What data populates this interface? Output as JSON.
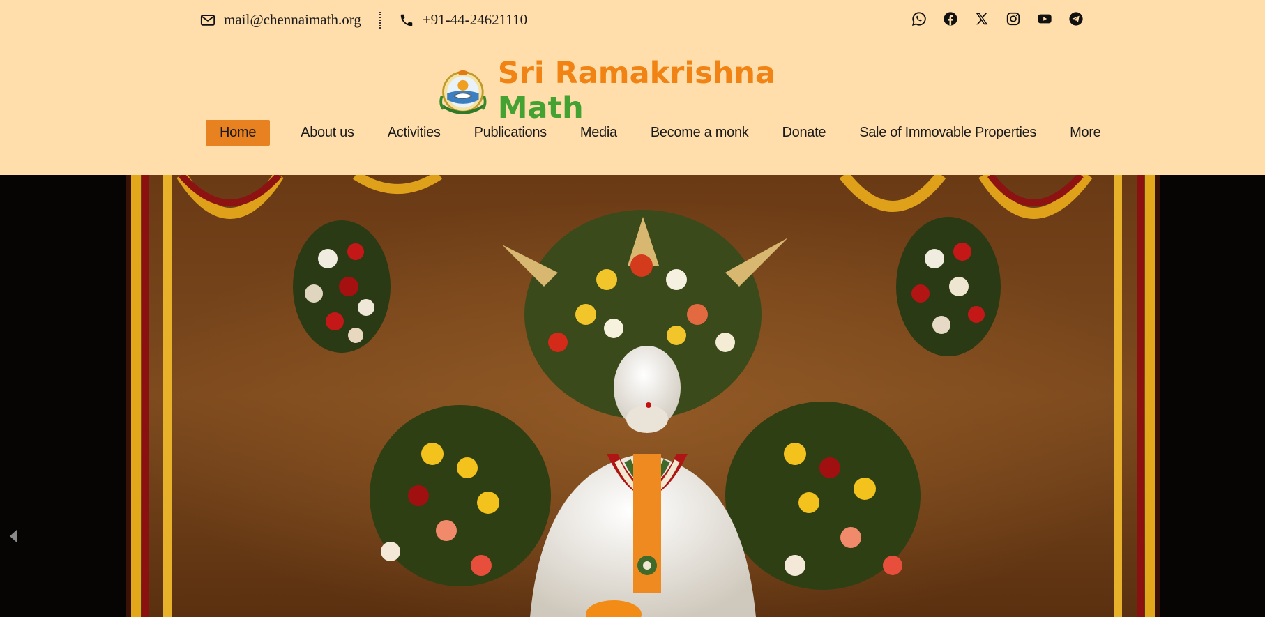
{
  "contact": {
    "email": "mail@chennaimath.org",
    "phone": "+91-44-24621110"
  },
  "social": [
    "whatsapp-icon",
    "facebook-icon",
    "x-icon",
    "instagram-icon",
    "youtube-icon",
    "telegram-icon"
  ],
  "brand": {
    "part1": "Sri Ramakrishna",
    "part2": "Math",
    "color1": "#f08313",
    "color2": "#44a233"
  },
  "nav": {
    "items": [
      {
        "label": "Home"
      },
      {
        "label": "About us"
      },
      {
        "label": "Activities"
      },
      {
        "label": "Publications"
      },
      {
        "label": "Media"
      },
      {
        "label": "Become a monk"
      },
      {
        "label": "Donate"
      },
      {
        "label": "Sale of Immovable Properties"
      },
      {
        "label": "More"
      }
    ],
    "active_color": "#e8811f"
  },
  "colors": {
    "background": "#ffdeab",
    "hero_bg": "#060504"
  }
}
